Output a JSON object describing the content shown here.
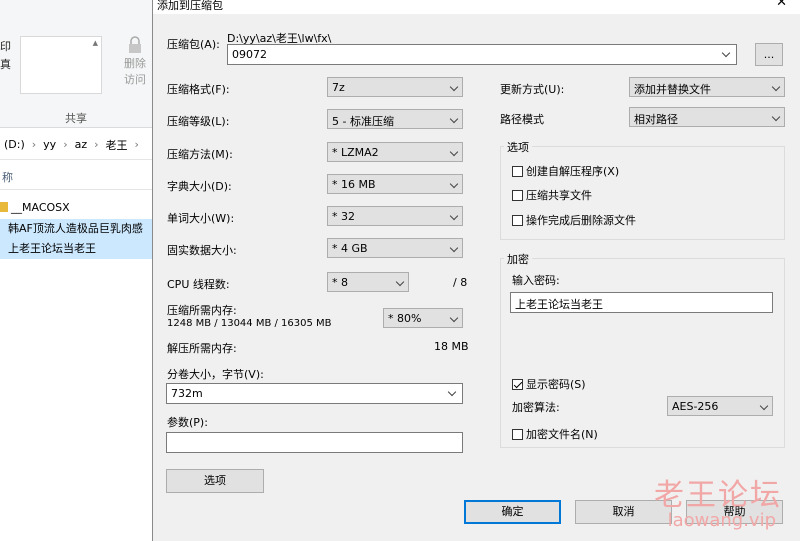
{
  "explorer": {
    "partial_labels": [
      "印",
      "真"
    ],
    "remove_access": "删除\n访问",
    "share_label": "共享",
    "breadcrumb": [
      "(D:)",
      "yy",
      "az",
      "老王"
    ],
    "column_name": "称",
    "files": [
      {
        "name": "__MACOSX",
        "selected": false
      },
      {
        "name": "韩AF顶流人造极品巨乳肉感",
        "selected": true
      },
      {
        "name": "上老王论坛当老王",
        "selected": true
      }
    ]
  },
  "dialog": {
    "title": "添加到压缩包",
    "archive_label": "压缩包(A):",
    "archive_path": "D:\\yy\\az\\老王\\lw\\fx\\",
    "archive_name": "09072",
    "browse_label": "...",
    "format_label": "压缩格式(F):",
    "format_value": "7z",
    "level_label": "压缩等级(L):",
    "level_value": "5 - 标准压缩",
    "method_label": "压缩方法(M):",
    "method_value": "* LZMA2",
    "dict_label": "字典大小(D):",
    "dict_value": "* 16 MB",
    "word_label": "单词大小(W):",
    "word_value": "* 32",
    "solid_label": "固实数据大小:",
    "solid_value": "* 4 GB",
    "cpu_label": "CPU 线程数:",
    "cpu_value": "* 8",
    "cpu_max": "/ 8",
    "mem_comp_label": "压缩所需内存:",
    "mem_comp_value": "1248 MB / 13044 MB / 16305 MB",
    "mem_percent": "* 80%",
    "mem_decomp_label": "解压所需内存:",
    "mem_decomp_value": "18 MB",
    "split_label": "分卷大小，字节(V):",
    "split_value": "732m",
    "params_label": "参数(P):",
    "params_value": "",
    "options_button": "选项",
    "update_label": "更新方式(U):",
    "update_value": "添加并替换文件",
    "path_label": "路径模式",
    "path_value": "相对路径",
    "options_group": "选项",
    "opt_sfx": "创建自解压程序(X)",
    "opt_shared": "压缩共享文件",
    "opt_delete": "操作完成后删除源文件",
    "encrypt_group": "加密",
    "password_label": "输入密码:",
    "password_value": "上老王论坛当老王",
    "show_password": "显示密码(S)",
    "enc_method_label": "加密算法:",
    "enc_method_value": "AES-256",
    "encrypt_names": "加密文件名(N)",
    "ok": "确定",
    "cancel": "取消",
    "help": "帮助",
    "close_glyph": "✕"
  },
  "watermark": {
    "line1": "老王论坛",
    "line2": "laowang.vip"
  },
  "state": {
    "show_password": true,
    "opt_sfx": false,
    "opt_shared": false,
    "opt_delete": false,
    "encrypt_names": false
  }
}
